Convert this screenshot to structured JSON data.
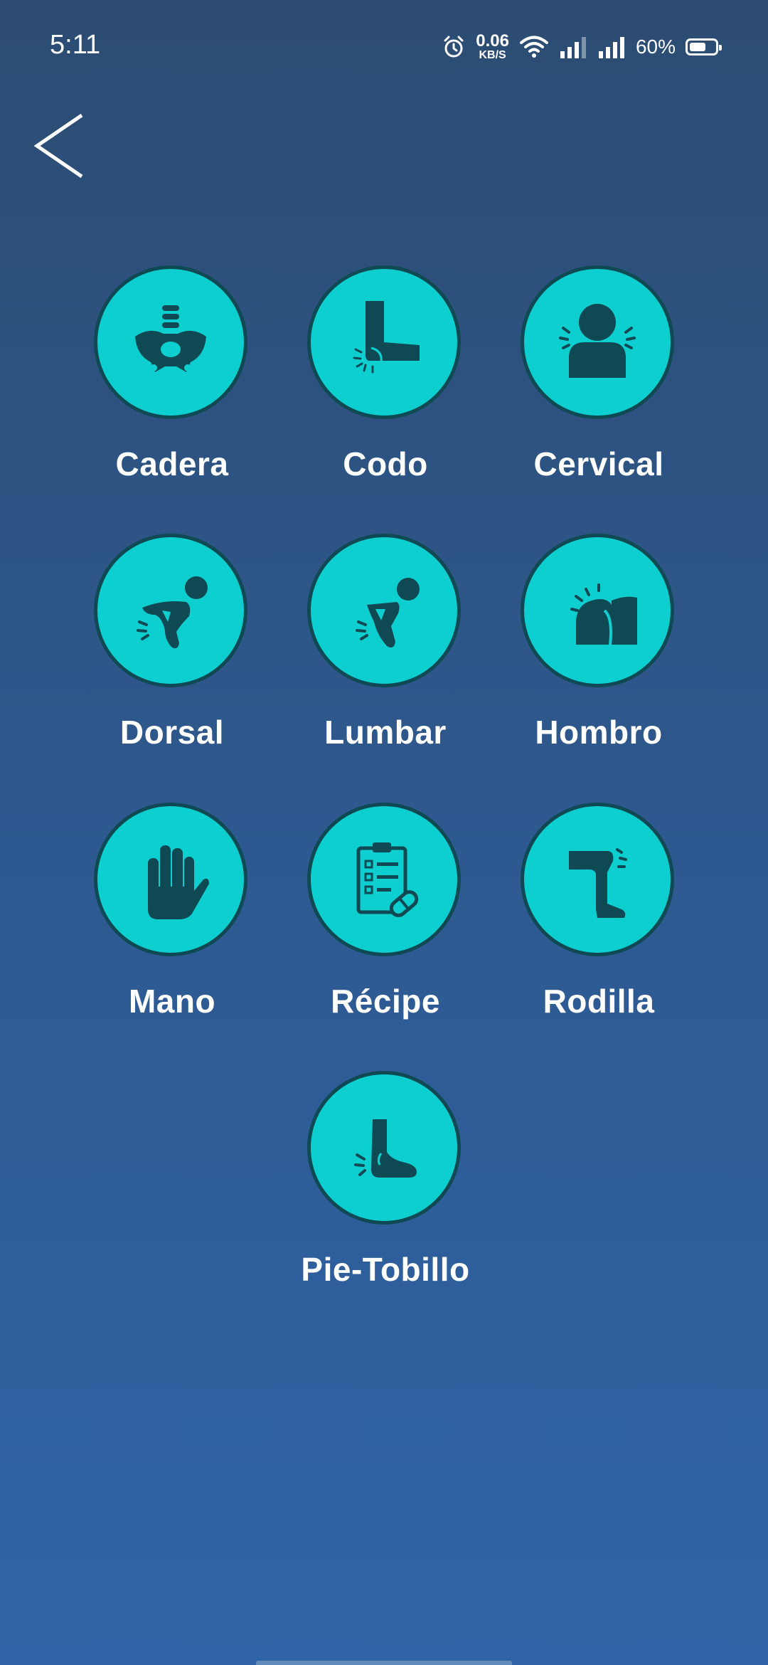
{
  "status_bar": {
    "time": "5:11",
    "net_speed_value": "0.06",
    "net_speed_unit": "KB/S",
    "battery_percent": "60%",
    "battery_level": 0.6
  },
  "nav": {
    "back_icon": "chevron-left-icon"
  },
  "colors": {
    "circle_fill": "#0ecfcf",
    "circle_border": "#0f4a54",
    "icon": "#0f4a54"
  },
  "categories": [
    {
      "label": "Cadera",
      "icon": "pelvis-icon"
    },
    {
      "label": "Codo",
      "icon": "elbow-icon"
    },
    {
      "label": "Cervical",
      "icon": "neck-icon"
    },
    {
      "label": "Dorsal",
      "icon": "upper-back-icon"
    },
    {
      "label": "Lumbar",
      "icon": "lower-back-icon"
    },
    {
      "label": "Hombro",
      "icon": "shoulder-icon"
    },
    {
      "label": "Mano",
      "icon": "hand-icon"
    },
    {
      "label": "Récipe",
      "icon": "prescription-icon"
    },
    {
      "label": "Rodilla",
      "icon": "knee-icon"
    },
    {
      "label": "Pie-Tobillo",
      "icon": "foot-icon"
    }
  ]
}
